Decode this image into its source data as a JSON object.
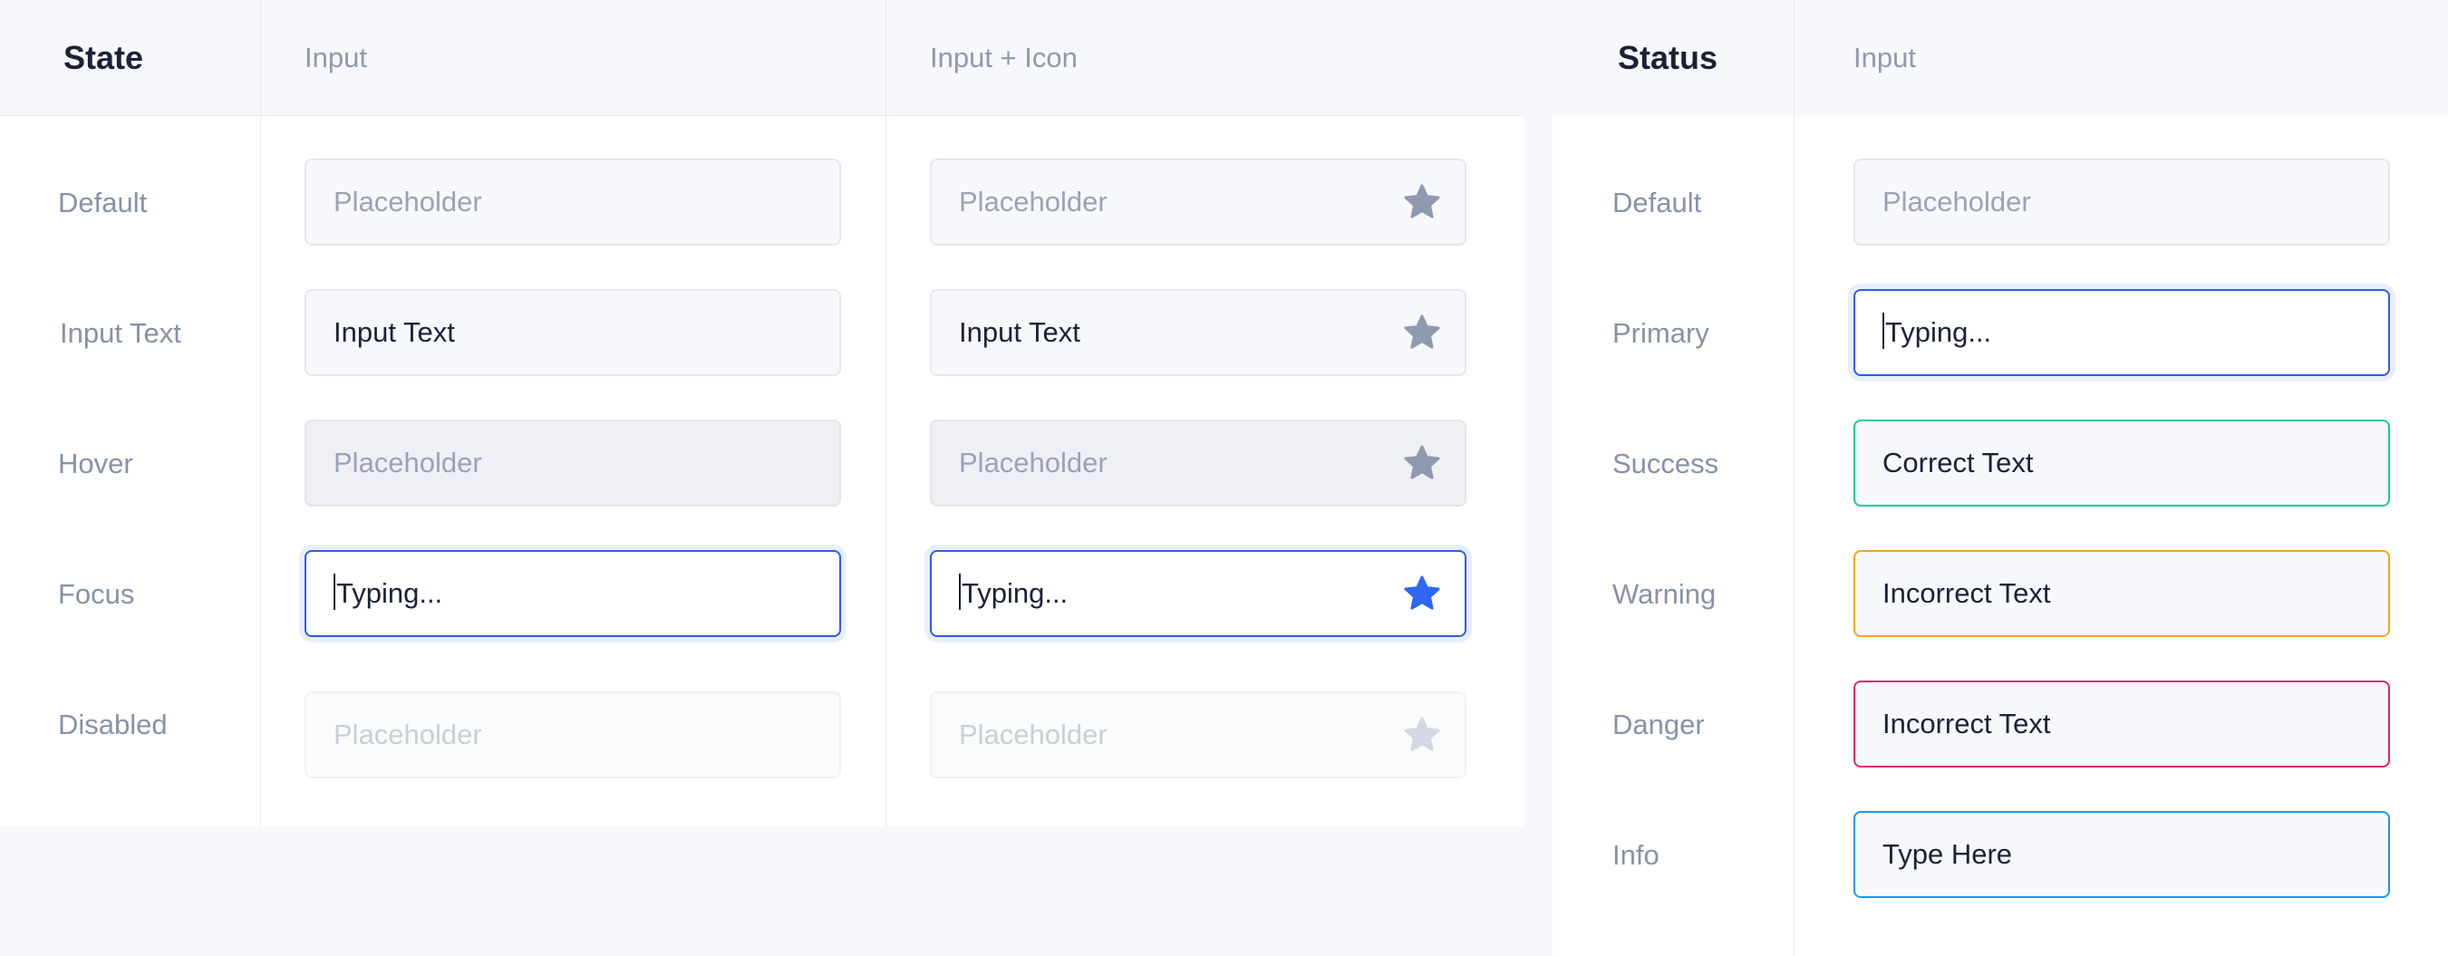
{
  "colors": {
    "star_default": "#8f9ab0",
    "star_active": "#2f66f3",
    "star_disabled": "#d3d8e2",
    "primary": "#2f5bea",
    "success": "#19c99a",
    "warning": "#f1a71c",
    "danger": "#e0246b",
    "info": "#1a9be0"
  },
  "states_table": {
    "headers": {
      "state": "State",
      "input": "Input",
      "input_icon": "Input + Icon"
    },
    "rows": [
      {
        "label": "Default",
        "input_text": "Placeholder",
        "icon_text": "Placeholder",
        "icon": "star-icon"
      },
      {
        "label": "Input Text",
        "input_text": "Input Text",
        "icon_text": "Input Text",
        "icon": "star-icon"
      },
      {
        "label": "Hover",
        "input_text": "Placeholder",
        "icon_text": "Placeholder",
        "icon": "star-icon"
      },
      {
        "label": "Focus",
        "input_text": "Typing...",
        "icon_text": "Typing...",
        "icon": "star-icon"
      },
      {
        "label": "Disabled",
        "input_text": "Placeholder",
        "icon_text": "Placeholder",
        "icon": "star-icon"
      }
    ]
  },
  "status_table": {
    "headers": {
      "status": "Status",
      "input": "Input"
    },
    "rows": [
      {
        "label": "Default",
        "text": "Placeholder"
      },
      {
        "label": "Primary",
        "text": "Typing..."
      },
      {
        "label": "Success",
        "text": "Correct Text"
      },
      {
        "label": "Warning",
        "text": "Incorrect Text"
      },
      {
        "label": "Danger",
        "text": "Incorrect Text"
      },
      {
        "label": "Info",
        "text": "Type Here"
      }
    ]
  }
}
